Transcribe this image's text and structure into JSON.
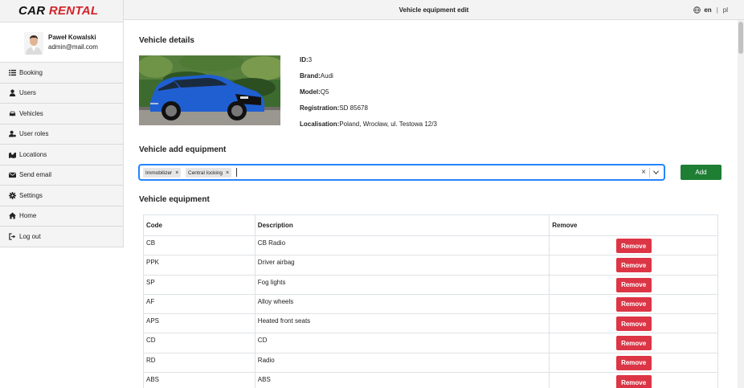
{
  "logo": {
    "part1": "CAR",
    "part2": "RENTAL"
  },
  "profile": {
    "name": "Paweł Kowalski",
    "email": "admin@mail.com"
  },
  "sidebar": {
    "items": [
      {
        "label": "Booking",
        "icon": "list-icon"
      },
      {
        "label": "Users",
        "icon": "user-icon"
      },
      {
        "label": "Vehicles",
        "icon": "car-icon"
      },
      {
        "label": "User roles",
        "icon": "user-cog-icon"
      },
      {
        "label": "Locations",
        "icon": "map-icon"
      },
      {
        "label": "Send email",
        "icon": "envelope-icon"
      },
      {
        "label": "Settings",
        "icon": "gear-icon"
      },
      {
        "label": "Home",
        "icon": "home-icon"
      },
      {
        "label": "Log out",
        "icon": "logout-icon"
      }
    ]
  },
  "header": {
    "title": "Vehicle equipment edit",
    "lang_en": "en",
    "lang_sep": "|",
    "lang_pl": "pl"
  },
  "vehicle_details": {
    "title": "Vehicle details",
    "id_label": "ID:",
    "id": "3",
    "brand_label": "Brand:",
    "brand": "Audi",
    "model_label": "Model:",
    "model": "Q5",
    "registration_label": "Registration:",
    "registration": "SD 85678",
    "localisation_label": "Localisation:",
    "localisation": "Poland, Wrocław, ul. Testowa 12/3"
  },
  "add_equipment": {
    "title": "Vehicle add equipment",
    "selected": [
      "Immobilizer",
      "Central locking"
    ],
    "add_label": "Add"
  },
  "equipment": {
    "title": "Vehicle equipment",
    "columns": [
      "Code",
      "Description",
      "Remove"
    ],
    "remove_label": "Remove",
    "rows": [
      {
        "code": "CB",
        "description": "CB Radio"
      },
      {
        "code": "PPK",
        "description": "Driver airbag"
      },
      {
        "code": "SP",
        "description": "Fog lights"
      },
      {
        "code": "AF",
        "description": "Alloy wheels"
      },
      {
        "code": "APS",
        "description": "Heated front seats"
      },
      {
        "code": "CD",
        "description": "CD"
      },
      {
        "code": "RD",
        "description": "Radio"
      },
      {
        "code": "ABS",
        "description": "ABS"
      }
    ]
  },
  "colors": {
    "brand_red": "#d2232a",
    "add_green": "#1e7e34",
    "remove_red": "#dc3545",
    "focus_blue": "#2684ff",
    "car_blue": "#1f5fd1"
  }
}
